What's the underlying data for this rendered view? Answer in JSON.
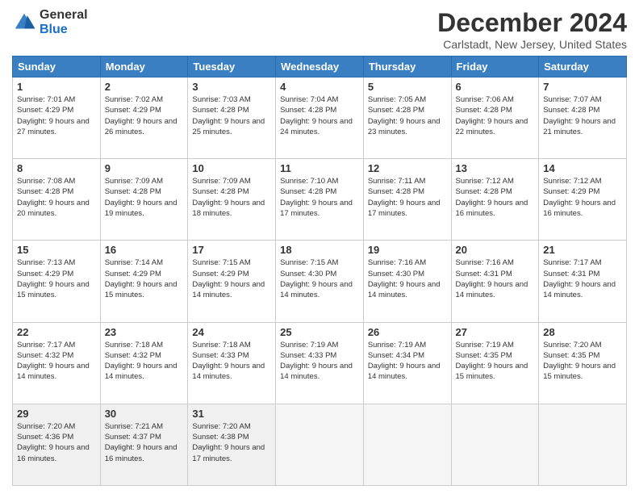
{
  "header": {
    "logo_general": "General",
    "logo_blue": "Blue",
    "title": "December 2024",
    "subtitle": "Carlstadt, New Jersey, United States"
  },
  "calendar": {
    "days_of_week": [
      "Sunday",
      "Monday",
      "Tuesday",
      "Wednesday",
      "Thursday",
      "Friday",
      "Saturday"
    ],
    "weeks": [
      [
        {
          "day": "1",
          "sunrise": "7:01 AM",
          "sunset": "4:29 PM",
          "daylight": "9 hours and 27 minutes."
        },
        {
          "day": "2",
          "sunrise": "7:02 AM",
          "sunset": "4:29 PM",
          "daylight": "9 hours and 26 minutes."
        },
        {
          "day": "3",
          "sunrise": "7:03 AM",
          "sunset": "4:28 PM",
          "daylight": "9 hours and 25 minutes."
        },
        {
          "day": "4",
          "sunrise": "7:04 AM",
          "sunset": "4:28 PM",
          "daylight": "9 hours and 24 minutes."
        },
        {
          "day": "5",
          "sunrise": "7:05 AM",
          "sunset": "4:28 PM",
          "daylight": "9 hours and 23 minutes."
        },
        {
          "day": "6",
          "sunrise": "7:06 AM",
          "sunset": "4:28 PM",
          "daylight": "9 hours and 22 minutes."
        },
        {
          "day": "7",
          "sunrise": "7:07 AM",
          "sunset": "4:28 PM",
          "daylight": "9 hours and 21 minutes."
        }
      ],
      [
        {
          "day": "8",
          "sunrise": "7:08 AM",
          "sunset": "4:28 PM",
          "daylight": "9 hours and 20 minutes."
        },
        {
          "day": "9",
          "sunrise": "7:09 AM",
          "sunset": "4:28 PM",
          "daylight": "9 hours and 19 minutes."
        },
        {
          "day": "10",
          "sunrise": "7:09 AM",
          "sunset": "4:28 PM",
          "daylight": "9 hours and 18 minutes."
        },
        {
          "day": "11",
          "sunrise": "7:10 AM",
          "sunset": "4:28 PM",
          "daylight": "9 hours and 17 minutes."
        },
        {
          "day": "12",
          "sunrise": "7:11 AM",
          "sunset": "4:28 PM",
          "daylight": "9 hours and 17 minutes."
        },
        {
          "day": "13",
          "sunrise": "7:12 AM",
          "sunset": "4:28 PM",
          "daylight": "9 hours and 16 minutes."
        },
        {
          "day": "14",
          "sunrise": "7:12 AM",
          "sunset": "4:29 PM",
          "daylight": "9 hours and 16 minutes."
        }
      ],
      [
        {
          "day": "15",
          "sunrise": "7:13 AM",
          "sunset": "4:29 PM",
          "daylight": "9 hours and 15 minutes."
        },
        {
          "day": "16",
          "sunrise": "7:14 AM",
          "sunset": "4:29 PM",
          "daylight": "9 hours and 15 minutes."
        },
        {
          "day": "17",
          "sunrise": "7:15 AM",
          "sunset": "4:29 PM",
          "daylight": "9 hours and 14 minutes."
        },
        {
          "day": "18",
          "sunrise": "7:15 AM",
          "sunset": "4:30 PM",
          "daylight": "9 hours and 14 minutes."
        },
        {
          "day": "19",
          "sunrise": "7:16 AM",
          "sunset": "4:30 PM",
          "daylight": "9 hours and 14 minutes."
        },
        {
          "day": "20",
          "sunrise": "7:16 AM",
          "sunset": "4:31 PM",
          "daylight": "9 hours and 14 minutes."
        },
        {
          "day": "21",
          "sunrise": "7:17 AM",
          "sunset": "4:31 PM",
          "daylight": "9 hours and 14 minutes."
        }
      ],
      [
        {
          "day": "22",
          "sunrise": "7:17 AM",
          "sunset": "4:32 PM",
          "daylight": "9 hours and 14 minutes."
        },
        {
          "day": "23",
          "sunrise": "7:18 AM",
          "sunset": "4:32 PM",
          "daylight": "9 hours and 14 minutes."
        },
        {
          "day": "24",
          "sunrise": "7:18 AM",
          "sunset": "4:33 PM",
          "daylight": "9 hours and 14 minutes."
        },
        {
          "day": "25",
          "sunrise": "7:19 AM",
          "sunset": "4:33 PM",
          "daylight": "9 hours and 14 minutes."
        },
        {
          "day": "26",
          "sunrise": "7:19 AM",
          "sunset": "4:34 PM",
          "daylight": "9 hours and 14 minutes."
        },
        {
          "day": "27",
          "sunrise": "7:19 AM",
          "sunset": "4:35 PM",
          "daylight": "9 hours and 15 minutes."
        },
        {
          "day": "28",
          "sunrise": "7:20 AM",
          "sunset": "4:35 PM",
          "daylight": "9 hours and 15 minutes."
        }
      ],
      [
        {
          "day": "29",
          "sunrise": "7:20 AM",
          "sunset": "4:36 PM",
          "daylight": "9 hours and 16 minutes."
        },
        {
          "day": "30",
          "sunrise": "7:21 AM",
          "sunset": "4:37 PM",
          "daylight": "9 hours and 16 minutes."
        },
        {
          "day": "31",
          "sunrise": "7:20 AM",
          "sunset": "4:38 PM",
          "daylight": "9 hours and 17 minutes."
        },
        null,
        null,
        null,
        null
      ]
    ]
  }
}
